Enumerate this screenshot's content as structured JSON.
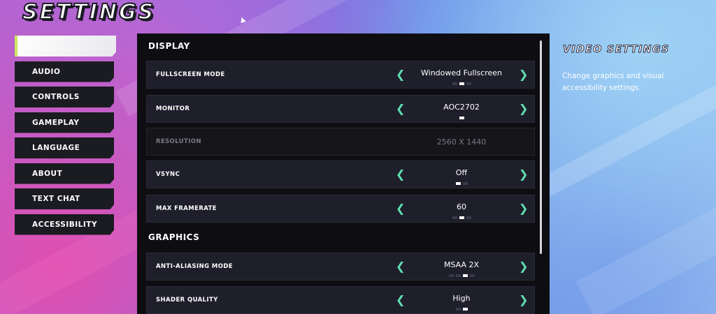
{
  "page_title": "SETTINGS",
  "nav": {
    "items": [
      {
        "label": "",
        "active": true
      },
      {
        "label": "AUDIO"
      },
      {
        "label": "CONTROLS"
      },
      {
        "label": "GAMEPLAY"
      },
      {
        "label": "LANGUAGE"
      },
      {
        "label": "ABOUT"
      },
      {
        "label": "TEXT CHAT"
      },
      {
        "label": "ACCESSIBILITY"
      }
    ]
  },
  "sections": {
    "display": "DISPLAY",
    "graphics": "GRAPHICS"
  },
  "settings": {
    "fullscreen_mode": {
      "label": "FULLSCREEN MODE",
      "value": "Windowed Fullscreen",
      "options_count": 3,
      "selected_index": 1
    },
    "monitor": {
      "label": "MONITOR",
      "value": "AOC2702",
      "options_count": 1,
      "selected_index": 0
    },
    "resolution": {
      "label": "RESOLUTION",
      "value": "2560 X 1440",
      "disabled": true
    },
    "vsync": {
      "label": "VSYNC",
      "value": "Off",
      "options_count": 2,
      "selected_index": 0
    },
    "max_framerate": {
      "label": "MAX FRAMERATE",
      "value": "60",
      "options_count": 3,
      "selected_index": 1
    },
    "anti_aliasing_mode": {
      "label": "ANTI-ALIASING MODE",
      "value": "MSAA 2X",
      "options_count": 4,
      "selected_index": 2
    },
    "shader_quality": {
      "label": "SHADER QUALITY",
      "value": "High",
      "options_count": 2,
      "selected_index": 1
    }
  },
  "info": {
    "title": "VIDEO SETTINGS",
    "description": "Change graphics and visual accessibility settings."
  },
  "icons": {
    "arrow_left": "chevron-left-icon",
    "arrow_right": "chevron-right-icon"
  },
  "colors": {
    "accent": "#5fe0b0",
    "active_marker": "#c9e85a",
    "panel_bg": "#0e0e12",
    "row_bg": "#1f1f2c"
  }
}
